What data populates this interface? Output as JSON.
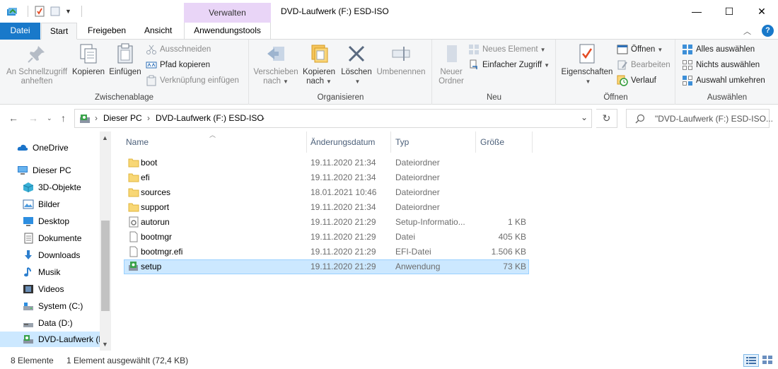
{
  "window": {
    "title": "DVD-Laufwerk (F:) ESD-ISO",
    "context_tab_header": "Verwalten",
    "minimize": "—",
    "maximize": "☐",
    "close": "✕"
  },
  "ribbon_tabs": {
    "file": "Datei",
    "start": "Start",
    "share": "Freigeben",
    "view": "Ansicht",
    "app_tools": "Anwendungstools",
    "collapse": "︿",
    "help": "?"
  },
  "ribbon": {
    "clipboard": {
      "label": "Zwischenablage",
      "pin_quick_access": "An Schnellzugriff anheften",
      "copy": "Kopieren",
      "paste": "Einfügen",
      "cut": "Ausschneiden",
      "copy_path": "Pfad kopieren",
      "paste_shortcut": "Verknüpfung einfügen"
    },
    "organize": {
      "label": "Organisieren",
      "move_to": "Verschieben nach",
      "copy_to": "Kopieren nach",
      "delete": "Löschen",
      "rename": "Umbenennen"
    },
    "new": {
      "label": "Neu",
      "new_folder": "Neuer Ordner",
      "new_item": "Neues Element",
      "easy_access": "Einfacher Zugriff"
    },
    "open": {
      "label": "Öffnen",
      "properties": "Eigenschaften",
      "open": "Öffnen",
      "edit": "Bearbeiten",
      "history": "Verlauf"
    },
    "select": {
      "label": "Auswählen",
      "select_all": "Alles auswählen",
      "select_none": "Nichts auswählen",
      "invert": "Auswahl umkehren"
    }
  },
  "address": {
    "crumbs": [
      "Dieser PC",
      "DVD-Laufwerk (F:) ESD-ISO"
    ],
    "separator": "›",
    "search_placeholder": "\"DVD-Laufwerk (F:) ESD-ISO..."
  },
  "nav_pane": {
    "items": [
      {
        "label": "OneDrive",
        "icon": "cloud-icon"
      },
      {
        "label": "Dieser PC",
        "icon": "computer-icon"
      },
      {
        "label": "3D-Objekte",
        "icon": "cube-icon"
      },
      {
        "label": "Bilder",
        "icon": "pictures-icon"
      },
      {
        "label": "Desktop",
        "icon": "desktop-icon"
      },
      {
        "label": "Dokumente",
        "icon": "documents-icon"
      },
      {
        "label": "Downloads",
        "icon": "download-icon"
      },
      {
        "label": "Musik",
        "icon": "music-icon"
      },
      {
        "label": "Videos",
        "icon": "video-icon"
      },
      {
        "label": "System (C:)",
        "icon": "drive-icon"
      },
      {
        "label": "Data (D:)",
        "icon": "drive-icon"
      },
      {
        "label": "DVD-Laufwerk (F",
        "icon": "dvd-drive-icon"
      }
    ]
  },
  "file_list": {
    "columns": {
      "name": "Name",
      "date": "Änderungsdatum",
      "type": "Typ",
      "size": "Größe"
    },
    "rows": [
      {
        "name": "boot",
        "date": "19.11.2020 21:34",
        "type": "Dateiordner",
        "size": "",
        "icon": "folder-icon"
      },
      {
        "name": "efi",
        "date": "19.11.2020 21:34",
        "type": "Dateiordner",
        "size": "",
        "icon": "folder-icon"
      },
      {
        "name": "sources",
        "date": "18.01.2021 10:46",
        "type": "Dateiordner",
        "size": "",
        "icon": "folder-icon"
      },
      {
        "name": "support",
        "date": "19.11.2020 21:34",
        "type": "Dateiordner",
        "size": "",
        "icon": "folder-icon"
      },
      {
        "name": "autorun",
        "date": "19.11.2020 21:29",
        "type": "Setup-Informatio...",
        "size": "1 KB",
        "icon": "settings-file-icon"
      },
      {
        "name": "bootmgr",
        "date": "19.11.2020 21:29",
        "type": "Datei",
        "size": "405 KB",
        "icon": "file-icon"
      },
      {
        "name": "bootmgr.efi",
        "date": "19.11.2020 21:29",
        "type": "EFI-Datei",
        "size": "1.506 KB",
        "icon": "file-icon"
      },
      {
        "name": "setup",
        "date": "19.11.2020 21:29",
        "type": "Anwendung",
        "size": "73 KB",
        "icon": "setup-app-icon",
        "selected": true
      }
    ]
  },
  "status": {
    "count": "8 Elemente",
    "selection": "1 Element ausgewählt (72,4 KB)"
  }
}
